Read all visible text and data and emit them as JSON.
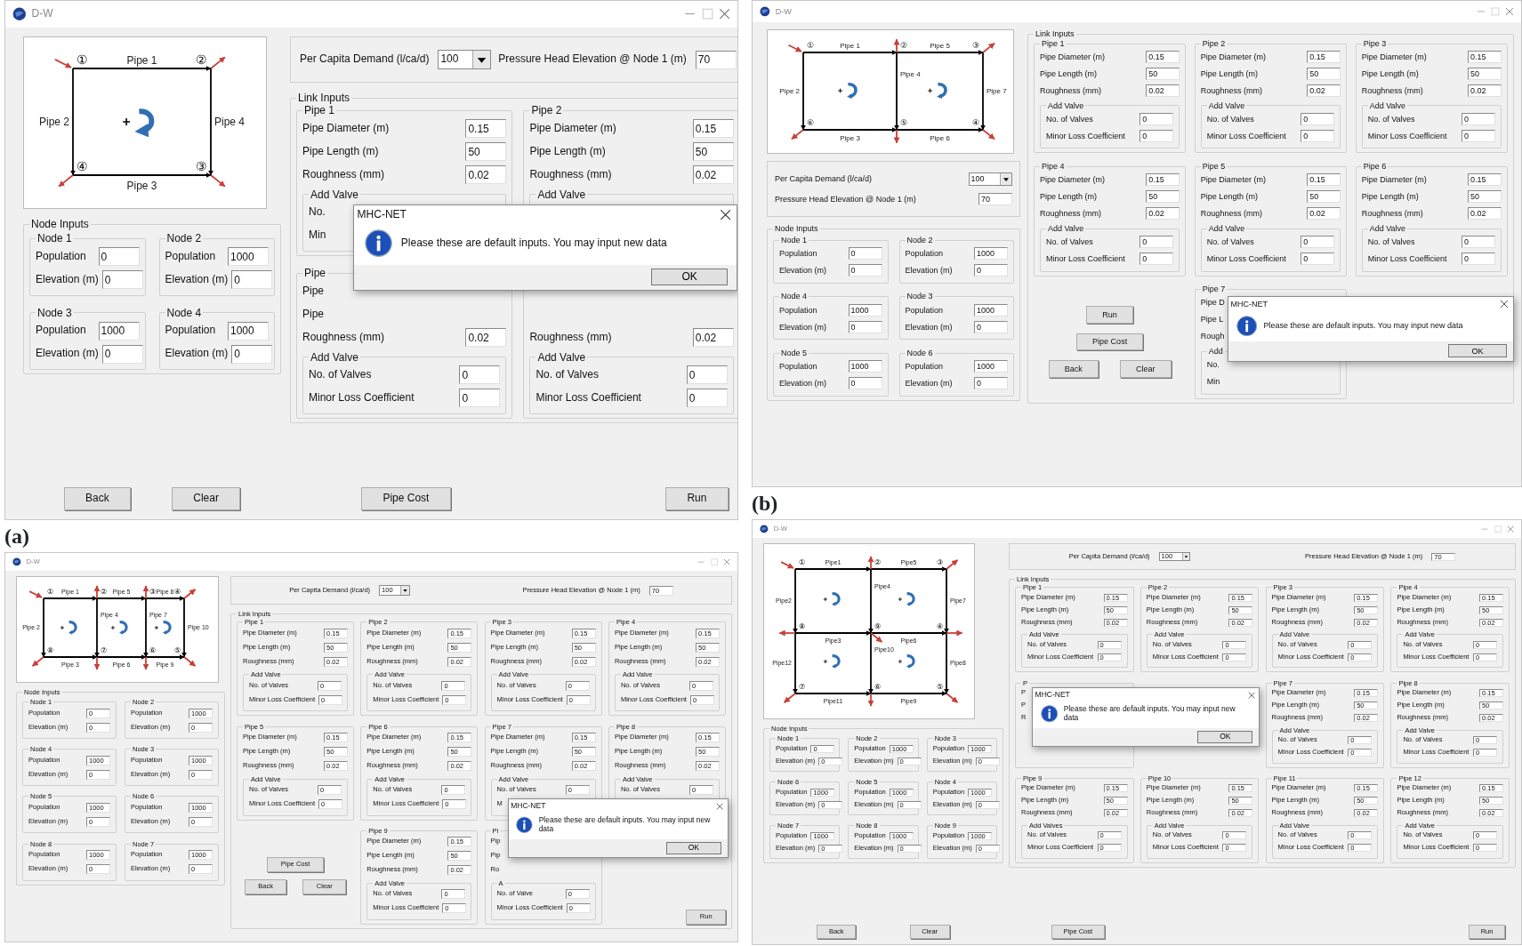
{
  "windows": [
    {
      "title": "D-W",
      "caption": "(a)",
      "diagram": {
        "pipes": [
          "Pipe 1",
          "Pipe 2",
          "Pipe 4",
          "Pipe 3"
        ],
        "nodes": [
          "①",
          "②",
          "④",
          "③"
        ]
      },
      "demand": {
        "label": "Per Capita Demand (l/ca/d)",
        "value": "100"
      },
      "head": {
        "label": "Pressure Head Elevation @ Node 1 (m)",
        "value": "70"
      },
      "link_inputs": {
        "title": "Link Inputs",
        "pipes": [
          {
            "title": "Pipe 1",
            "fields": [
              {
                "label": "Pipe Diameter (m)",
                "value": "0.15"
              },
              {
                "label": "Pipe Length (m)",
                "value": "50"
              },
              {
                "label": "Roughness (mm)",
                "value": "0.02"
              }
            ],
            "valve": {
              "title": "Add Valve",
              "fields": [
                {
                  "label": "No."
                },
                {
                  "label": "Min"
                }
              ]
            }
          },
          {
            "title": "Pipe 2",
            "fields": [
              {
                "label": "Pipe Diameter (m)",
                "value": "0.15"
              },
              {
                "label": "Pipe Length (m)",
                "value": "50"
              },
              {
                "label": "Roughness (mm)",
                "value": "0.02"
              }
            ],
            "valve": {
              "title": "Add Valve"
            }
          },
          {
            "title": "Pipe",
            "fields": [
              {
                "label": "Pipe"
              },
              {
                "label": "Pipe"
              },
              {
                "label": "Roughness (mm)",
                "value": "0.02"
              }
            ],
            "valve": {
              "title": "Add Valve",
              "fields": [
                {
                  "label": "No. of Valves",
                  "value": "0"
                },
                {
                  "label": "Minor Loss Coefficient",
                  "value": "0"
                }
              ]
            }
          },
          {
            "fields": [
              {
                "label": "Roughness (mm)",
                "value": "0.02"
              }
            ],
            "valve": {
              "title": "Add Valve",
              "fields": [
                {
                  "label": "No. of Valves",
                  "value": "0"
                },
                {
                  "label": "Minor Loss Coefficient",
                  "value": "0"
                }
              ]
            }
          }
        ]
      },
      "node_inputs": {
        "title": "Node Inputs",
        "nodes": [
          {
            "title": "Node 1",
            "fields": [
              {
                "label": "Population",
                "value": "0"
              },
              {
                "label": "Elevation (m)",
                "value": "0"
              }
            ]
          },
          {
            "title": "Node 2",
            "fields": [
              {
                "label": "Population",
                "value": "1000"
              },
              {
                "label": "Elevation (m)",
                "value": "0"
              }
            ]
          },
          {
            "title": "Node 3",
            "fields": [
              {
                "label": "Population",
                "value": "1000"
              },
              {
                "label": "Elevation (m)",
                "value": "0"
              }
            ]
          },
          {
            "title": "Node 4",
            "fields": [
              {
                "label": "Population",
                "value": "1000"
              },
              {
                "label": "Elevation (m)",
                "value": "0"
              }
            ]
          }
        ]
      },
      "buttons": [
        "Back",
        "Clear",
        "Pipe Cost",
        "Run"
      ],
      "dialog": {
        "title": "MHC-NET",
        "message": "Please these are default inputs. You may input new data",
        "button": "OK"
      }
    },
    {
      "title": "D-W",
      "caption": "(b)",
      "diagram": {
        "pipes": [
          "Pipe 1",
          "Pipe 5",
          "Pipe 2",
          "Pipe 4",
          "Pipe 7",
          "Pipe 3",
          "Pipe 6"
        ],
        "nodes": [
          "①",
          "②",
          "③",
          "⑥",
          "⑤",
          "④"
        ]
      },
      "demand": {
        "label": "Per Capita Demand (l/ca/d)",
        "value": "100"
      },
      "head": {
        "label": "Pressure Head Elevation @ Node 1 (m)",
        "value": "70"
      },
      "link_inputs": {
        "title": "Link Inputs",
        "pipes": [
          {
            "title": "Pipe 1",
            "fields": [
              {
                "label": "Pipe Diameter (m)",
                "value": "0.15"
              },
              {
                "label": "Pipe Length (m)",
                "value": "50"
              },
              {
                "label": "Roughness (mm)",
                "value": "0.02"
              }
            ],
            "valve": {
              "title": "Add Valve",
              "fields": [
                {
                  "label": "No. of Valves",
                  "value": "0"
                },
                {
                  "label": "Minor Loss Coefficient",
                  "value": "0"
                }
              ]
            }
          },
          {
            "title": "Pipe 2",
            "fields": [
              {
                "label": "Pipe Diameter (m)",
                "value": "0.15"
              },
              {
                "label": "Pipe Length (m)",
                "value": "50"
              },
              {
                "label": "Roughness (mm)",
                "value": "0.02"
              }
            ],
            "valve": {
              "title": "Add Valve",
              "fields": [
                {
                  "label": "No. of Valves",
                  "value": "0"
                },
                {
                  "label": "Minor Loss Coefficient",
                  "value": "0"
                }
              ]
            }
          },
          {
            "title": "Pipe 3",
            "fields": [
              {
                "label": "Pipe Diameter (m)",
                "value": "0.15"
              },
              {
                "label": "Pipe Length (m)",
                "value": "50"
              },
              {
                "label": "Roughness (mm)",
                "value": "0.02"
              }
            ],
            "valve": {
              "title": "Add Valve",
              "fields": [
                {
                  "label": "No. of Valves",
                  "value": "0"
                },
                {
                  "label": "Minor Loss Coefficient",
                  "value": "0"
                }
              ]
            }
          },
          {
            "title": "Pipe 4",
            "fields": [
              {
                "label": "Pipe Diameter (m)",
                "value": "0.15"
              },
              {
                "label": "Pipe Length (m)",
                "value": "50"
              },
              {
                "label": "Roughness (mm)",
                "value": "0.02"
              }
            ],
            "valve": {
              "title": "Add Valve",
              "fields": [
                {
                  "label": "No. of Valves",
                  "value": "0"
                },
                {
                  "label": "Minor Loss Coefficient",
                  "value": "0"
                }
              ]
            }
          },
          {
            "title": "Pipe 5",
            "fields": [
              {
                "label": "Pipe Diameter (m)",
                "value": "0.15"
              },
              {
                "label": "Pipe Length (m)",
                "value": "50"
              },
              {
                "label": "Roughness (mm)",
                "value": "0.02"
              }
            ],
            "valve": {
              "title": "Add Valve",
              "fields": [
                {
                  "label": "No. of Valves",
                  "value": "0"
                },
                {
                  "label": "Minor Loss Coefficient",
                  "value": "0"
                }
              ]
            }
          },
          {
            "title": "Pipe 6",
            "fields": [
              {
                "label": "Pipe Diameter (m)",
                "value": "0.15"
              },
              {
                "label": "Pipe Length (m)",
                "value": "50"
              },
              {
                "label": "Roughness (mm)",
                "value": "0.02"
              }
            ],
            "valve": {
              "title": "Add Valve",
              "fields": [
                {
                  "label": "No. of Valves",
                  "value": "0"
                },
                {
                  "label": "Minor Loss Coefficient",
                  "value": "0"
                }
              ]
            }
          },
          {
            "title": "Pipe 7",
            "fields": [
              {
                "label": "Pipe D"
              },
              {
                "label": "Pipe L"
              },
              {
                "label": "Rough"
              }
            ],
            "valve": {
              "title": "Add",
              "fields": [
                {
                  "label": "No."
                },
                {
                  "label": "Min"
                }
              ]
            }
          }
        ]
      },
      "node_inputs": {
        "title": "Node Inputs",
        "nodes": [
          {
            "title": "Node 1",
            "fields": [
              {
                "label": "Population",
                "value": "0"
              },
              {
                "label": "Elevation (m)",
                "value": "0"
              }
            ]
          },
          {
            "title": "Node 2",
            "fields": [
              {
                "label": "Population",
                "value": "1000"
              },
              {
                "label": "Elevation (m)",
                "value": "0"
              }
            ]
          },
          {
            "title": "Node 4",
            "fields": [
              {
                "label": "Population",
                "value": "1000"
              },
              {
                "label": "Elevation (m)",
                "value": "0"
              }
            ]
          },
          {
            "title": "Node 3",
            "fields": [
              {
                "label": "Population",
                "value": "1000"
              },
              {
                "label": "Elevation (m)",
                "value": "0"
              }
            ]
          },
          {
            "title": "Node 5",
            "fields": [
              {
                "label": "Population",
                "value": "1000"
              },
              {
                "label": "Elevation (m)",
                "value": "0"
              }
            ]
          },
          {
            "title": "Node 6",
            "fields": [
              {
                "label": "Population",
                "value": "1000"
              },
              {
                "label": "Elevation (m)",
                "value": "0"
              }
            ]
          }
        ]
      },
      "buttons": [
        "Run",
        "Pipe Cost",
        "Back",
        "Clear"
      ],
      "dialog": {
        "title": "MHC-NET",
        "message": "Please these are default inputs. You may input new data",
        "button": "OK"
      }
    },
    {
      "title": "D-W",
      "diagram": {
        "pipes": [
          "Pipe 1",
          "Pipe 5",
          "Pipe 8",
          "Pipe 2",
          "Pipe 4",
          "Pipe 7",
          "Pipe 10",
          "Pipe 3",
          "Pipe 6",
          "Pipe 9"
        ],
        "nodes": [
          "①",
          "②",
          "③",
          "④",
          "⑧",
          "⑦",
          "⑥",
          "⑤"
        ]
      },
      "demand": {
        "label": "Per Capita Demand (l/ca/d)",
        "value": "100"
      },
      "head": {
        "label": "Pressure Head Elevation @ Node 1 (m)",
        "value": "70"
      },
      "link_inputs": {
        "title": "Link Inputs",
        "pipes": [
          {
            "title": "Pipe 1",
            "fields": [
              {
                "label": "Pipe Diameter (m)",
                "value": "0.15"
              },
              {
                "label": "Pipe Length (m)",
                "value": "50"
              },
              {
                "label": "Roughness (mm)",
                "value": "0.02"
              }
            ],
            "valve": {
              "title": "Add Valve",
              "fields": [
                {
                  "label": "No. of Valves",
                  "value": "0"
                },
                {
                  "label": "Minor Loss Coefficient",
                  "value": "0"
                }
              ]
            }
          },
          {
            "title": "Pipe 2",
            "fields": [
              {
                "label": "Pipe Diameter (m)",
                "value": "0.15"
              },
              {
                "label": "Pipe Length (m)",
                "value": "50"
              },
              {
                "label": "Roughness (mm)",
                "value": "0.02"
              }
            ],
            "valve": {
              "title": "Add Valve",
              "fields": [
                {
                  "label": "No. of Valves",
                  "value": "0"
                },
                {
                  "label": "Minor Loss Coefficient",
                  "value": "0"
                }
              ]
            }
          },
          {
            "title": "Pipe 3",
            "fields": [
              {
                "label": "Pipe Diameter (m)",
                "value": "0.15"
              },
              {
                "label": "Pipe Length (m)",
                "value": "50"
              },
              {
                "label": "Roughness (mm)",
                "value": "0.02"
              }
            ],
            "valve": {
              "title": "Add Valve",
              "fields": [
                {
                  "label": "No. of Valves",
                  "value": "0"
                },
                {
                  "label": "Minor Loss Coefficient",
                  "value": "0"
                }
              ]
            }
          },
          {
            "title": "Pipe 4",
            "fields": [
              {
                "label": "Pipe Diameter (m)",
                "value": "0.15"
              },
              {
                "label": "Pipe Length (m)",
                "value": "50"
              },
              {
                "label": "Roughness (mm)",
                "value": "0.02"
              }
            ],
            "valve": {
              "title": "Add Valve",
              "fields": [
                {
                  "label": "No. of Valves",
                  "value": "0"
                },
                {
                  "label": "Minor Loss Coefficient",
                  "value": "0"
                }
              ]
            }
          },
          {
            "title": "Pipe 5",
            "fields": [
              {
                "label": "Pipe Diameter (m)",
                "value": "0.15"
              },
              {
                "label": "Pipe Length (m)",
                "value": "50"
              },
              {
                "label": "Roughness (mm)",
                "value": "0.02"
              }
            ],
            "valve": {
              "title": "Add Valve",
              "fields": [
                {
                  "label": "No. of Valves",
                  "value": "0"
                },
                {
                  "label": "Minor Loss Coefficient",
                  "value": "0"
                }
              ]
            }
          },
          {
            "title": "Pipe 6",
            "fields": [
              {
                "label": "Pipe Diameter (m)",
                "value": "0.15"
              },
              {
                "label": "Pipe Length (m)",
                "value": "50"
              },
              {
                "label": "Roughness (mm)",
                "value": "0.02"
              }
            ],
            "valve": {
              "title": "Add Valve",
              "fields": [
                {
                  "label": "No. of Valves",
                  "value": "0"
                },
                {
                  "label": "Minor Loss Coefficient",
                  "value": "0"
                }
              ]
            }
          },
          {
            "title": "Pipe 7",
            "fields": [
              {
                "label": "Pipe Diameter (m)",
                "value": "0.15"
              },
              {
                "label": "Pipe Length (m)",
                "value": "50"
              },
              {
                "label": "Roughness (mm)",
                "value": "0.02"
              }
            ],
            "valve": {
              "title": "Add Valve",
              "fields": [
                {
                  "label": "No. of Valves",
                  "value": "0"
                },
                {
                  "label": "M"
                }
              ]
            }
          },
          {
            "title": "Pipe 8",
            "fields": [
              {
                "label": "Pipe Diameter (m)",
                "value": "0.15"
              },
              {
                "label": "Pipe Length (m)",
                "value": "50"
              },
              {
                "label": "Roughness (mm)",
                "value": "0.02"
              }
            ],
            "valve": {
              "title": "Add Valve",
              "fields": [
                {
                  "label": "No. of Valves",
                  "value": "0"
                }
              ]
            }
          },
          {
            "title": "Pipe 9",
            "fields": [
              {
                "label": "Pipe Diameter (m)",
                "value": "0.15"
              },
              {
                "label": "Pipe Length (m)",
                "value": "50"
              },
              {
                "label": "Roughness (mm)",
                "value": "0.02"
              }
            ],
            "valve": {
              "title": "Add Valve",
              "fields": [
                {
                  "label": "No. of Valves",
                  "value": "0"
                },
                {
                  "label": "Minor Loss Coefficient",
                  "value": "0"
                }
              ]
            }
          },
          {
            "title": "Pi",
            "fields": [
              {
                "label": "Pip"
              },
              {
                "label": "Pip"
              },
              {
                "label": "Ro"
              }
            ],
            "valve": {
              "title": "A",
              "fields": [
                {
                  "label": "No. of Valve",
                  "value": "0"
                },
                {
                  "label": "Minor Loss Coefficient",
                  "value": "0"
                }
              ]
            }
          }
        ]
      },
      "node_inputs": {
        "title": "Node Inputs",
        "nodes": [
          {
            "title": "Node 1",
            "fields": [
              {
                "label": "Population",
                "value": "0"
              },
              {
                "label": "Elevation (m)",
                "value": "0"
              }
            ]
          },
          {
            "title": "Node 2",
            "fields": [
              {
                "label": "Population",
                "value": "1000"
              },
              {
                "label": "Elevation (m)",
                "value": "0"
              }
            ]
          },
          {
            "title": "Node 4",
            "fields": [
              {
                "label": "Population",
                "value": "1000"
              },
              {
                "label": "Elevation (m)",
                "value": "0"
              }
            ]
          },
          {
            "title": "Node 3",
            "fields": [
              {
                "label": "Population",
                "value": "1000"
              },
              {
                "label": "Elevation (m)",
                "value": "0"
              }
            ]
          },
          {
            "title": "Node 5",
            "fields": [
              {
                "label": "Population",
                "value": "1000"
              },
              {
                "label": "Elevation (m)",
                "value": "0"
              }
            ]
          },
          {
            "title": "Node 6",
            "fields": [
              {
                "label": "Population",
                "value": "1000"
              },
              {
                "label": "Elevation (m)",
                "value": "0"
              }
            ]
          },
          {
            "title": "Node 8",
            "fields": [
              {
                "label": "Population",
                "value": "1000"
              },
              {
                "label": "Elevation (m)",
                "value": "0"
              }
            ]
          },
          {
            "title": "Node 7",
            "fields": [
              {
                "label": "Population",
                "value": "1000"
              },
              {
                "label": "Elevation (m)",
                "value": "0"
              }
            ]
          }
        ]
      },
      "buttons": [
        "Pipe Cost",
        "Back",
        "Clear",
        "Run"
      ],
      "dialog": {
        "title": "MHC-NET",
        "message": "Please these are default inputs. You may input new data",
        "button": "OK"
      }
    },
    {
      "title": "D-W",
      "diagram": {
        "pipes": [
          "Pipe1",
          "Pipe5",
          "Pipe2",
          "Pipe4",
          "Pipe7",
          "Pipe3",
          "Pipe6",
          "Pipe12",
          "Pipe10",
          "Pipe8",
          "Pipe11",
          "Pipe9"
        ],
        "nodes": [
          "①",
          "②",
          "③",
          "⑧",
          "⑨",
          "④",
          "⑦",
          "⑥",
          "⑤"
        ]
      },
      "demand": {
        "label": "Per Capita Demand (l/ca/d)",
        "value": "100"
      },
      "head": {
        "label": "Pressure Head Elevation @ Node 1 (m)",
        "value": "70"
      },
      "link_inputs": {
        "title": "Link Inputs",
        "pipes": [
          {
            "title": "Pipe 1",
            "fields": [
              {
                "label": "Pipe Diameter (m)",
                "value": "0.15"
              },
              {
                "label": "Pipe Length (m)",
                "value": "50"
              },
              {
                "label": "Roughness (mm)",
                "value": "0.02"
              }
            ],
            "valve": {
              "title": "Add Valve",
              "fields": [
                {
                  "label": "No. of Valves",
                  "value": "0"
                },
                {
                  "label": "Minor Loss Coefficient",
                  "value": "0"
                }
              ]
            }
          },
          {
            "title": "Pipe 2",
            "fields": [
              {
                "label": "Pipe Diameter (m)",
                "value": "0.15"
              },
              {
                "label": "Pipe Length (m)",
                "value": "50"
              },
              {
                "label": "Roughness (mm)",
                "value": "0.02"
              }
            ],
            "valve": {
              "title": "Add Valve",
              "fields": [
                {
                  "label": "No. of Valves",
                  "value": "0"
                },
                {
                  "label": "Minor Loss Coefficient",
                  "value": "0"
                }
              ]
            }
          },
          {
            "title": "Pipe 3",
            "fields": [
              {
                "label": "Pipe Diameter (m)",
                "value": "0.15"
              },
              {
                "label": "Pipe Length (m)",
                "value": "50"
              },
              {
                "label": "Roughness (mm)",
                "value": "0.02"
              }
            ],
            "valve": {
              "title": "Add Valve",
              "fields": [
                {
                  "label": "No. of Valves",
                  "value": "0"
                },
                {
                  "label": "Minor Loss Coefficient",
                  "value": "0"
                }
              ]
            }
          },
          {
            "title": "Pipe 4",
            "fields": [
              {
                "label": "Pipe Diameter (m)",
                "value": "0.15"
              },
              {
                "label": "Pipe Length (m)",
                "value": "50"
              },
              {
                "label": "Roughness (mm)",
                "value": "0.02"
              }
            ],
            "valve": {
              "title": "Add Valve",
              "fields": [
                {
                  "label": "No. of Valves",
                  "value": "0"
                },
                {
                  "label": "Minor Loss Coefficient",
                  "value": "0"
                }
              ]
            }
          },
          {
            "title": "P",
            "fields": [
              {
                "label": "P"
              },
              {
                "label": "P"
              },
              {
                "label": "R"
              }
            ]
          },
          {
            "title": "Pipe 7",
            "fields": [
              {
                "label": "Pipe Diameter (m)",
                "value": "0.15"
              },
              {
                "label": "Pipe Length (m)",
                "value": "50"
              },
              {
                "label": "Roughness (mm)",
                "value": "0.02"
              }
            ],
            "valve": {
              "title": "Add Valve",
              "fields": [
                {
                  "label": "No. of Valves",
                  "value": "0"
                },
                {
                  "label": "Minor Loss Coefficient",
                  "value": "0"
                }
              ]
            }
          },
          {
            "title": "Pipe 8",
            "fields": [
              {
                "label": "Pipe Diameter (m)",
                "value": "0.15"
              },
              {
                "label": "Pipe Length (m)",
                "value": "50"
              },
              {
                "label": "Roughness (mm)",
                "value": "0.02"
              }
            ],
            "valve": {
              "title": "Add Valve",
              "fields": [
                {
                  "label": "No. of Valves",
                  "value": "0"
                },
                {
                  "label": "Minor Loss Coefficient",
                  "value": "0"
                }
              ]
            }
          },
          {
            "title": "Pipe 9",
            "fields": [
              {
                "label": "Pipe Diameter (m)",
                "value": "0.15"
              },
              {
                "label": "Pipe Length (m)",
                "value": "50"
              },
              {
                "label": "Roughness (mm)",
                "value": "0.02"
              }
            ],
            "valve": {
              "title": "Add Valves",
              "fields": [
                {
                  "label": "No. of Valves",
                  "value": "0"
                },
                {
                  "label": "Minor Loss Coefficient",
                  "value": "0"
                }
              ]
            }
          },
          {
            "title": "Pipe 10",
            "fields": [
              {
                "label": "Pipe Diameter (m)",
                "value": "0.15"
              },
              {
                "label": "Pipe Length (m)",
                "value": "50"
              },
              {
                "label": "Roughness (mm)",
                "value": "0.02"
              }
            ],
            "valve": {
              "title": "Add Valve",
              "fields": [
                {
                  "label": "No. of Valves",
                  "value": "0"
                },
                {
                  "label": "Minor Loss Coefficient",
                  "value": "0"
                }
              ]
            }
          },
          {
            "title": "Pipe 11",
            "fields": [
              {
                "label": "Pipe Diameter (m)",
                "value": "0.15"
              },
              {
                "label": "Pipe Length (m)",
                "value": "50"
              },
              {
                "label": "Roughness (mm)",
                "value": "0.02"
              }
            ],
            "valve": {
              "title": "Add Valve",
              "fields": [
                {
                  "label": "No. of Valves",
                  "value": "0"
                },
                {
                  "label": "Minor Loss Coefficient",
                  "value": "0"
                }
              ]
            }
          },
          {
            "title": "Pipe 12",
            "fields": [
              {
                "label": "Pipe Diameter (m)",
                "value": "0.15"
              },
              {
                "label": "Pipe Length (m)",
                "value": "50"
              },
              {
                "label": "Roughness (mm)",
                "value": "0.02"
              }
            ],
            "valve": {
              "title": "Add Valve",
              "fields": [
                {
                  "label": "No. of Valves",
                  "value": "0"
                },
                {
                  "label": "Minor Loss Coefficient",
                  "value": "0"
                }
              ]
            }
          }
        ]
      },
      "node_inputs": {
        "title": "Node Inputs",
        "nodes": [
          {
            "title": "Node 1",
            "fields": [
              {
                "label": "Population",
                "value": "0"
              },
              {
                "label": "Elevation (m)",
                "value": "0"
              }
            ]
          },
          {
            "title": "Node 2",
            "fields": [
              {
                "label": "Population",
                "value": "1000"
              },
              {
                "label": "Elevation (m)",
                "value": "0"
              }
            ]
          },
          {
            "title": "Node 3",
            "fields": [
              {
                "label": "Population",
                "value": "1000"
              },
              {
                "label": "Elevation (m)",
                "value": "0"
              }
            ]
          },
          {
            "title": "Node 6",
            "fields": [
              {
                "label": "Population",
                "value": "1000"
              },
              {
                "label": "Elevation (m)",
                "value": "0"
              }
            ]
          },
          {
            "title": "Node 5",
            "fields": [
              {
                "label": "Population",
                "value": "1000"
              },
              {
                "label": "Elevation (m)",
                "value": "0"
              }
            ]
          },
          {
            "title": "Node 4",
            "fields": [
              {
                "label": "Population",
                "value": "1000"
              },
              {
                "label": "Elevation (m)",
                "value": "0"
              }
            ]
          },
          {
            "title": "Node 7",
            "fields": [
              {
                "label": "Population",
                "value": "1000"
              },
              {
                "label": "Elevation (m)",
                "value": "0"
              }
            ]
          },
          {
            "title": "Node 8",
            "fields": [
              {
                "label": "Population",
                "value": "1000"
              },
              {
                "label": "Elevation (m)",
                "value": "0"
              }
            ]
          },
          {
            "title": "Node 9",
            "fields": [
              {
                "label": "Population",
                "value": "1000"
              },
              {
                "label": "Elevation (m)",
                "value": "0"
              }
            ]
          }
        ]
      },
      "buttons": [
        "Back",
        "Clear",
        "Pipe Cost",
        "Run"
      ],
      "dialog": {
        "title": "MHC-NET",
        "message": "Please these are default inputs. You may input new data",
        "button": "OK"
      }
    }
  ]
}
